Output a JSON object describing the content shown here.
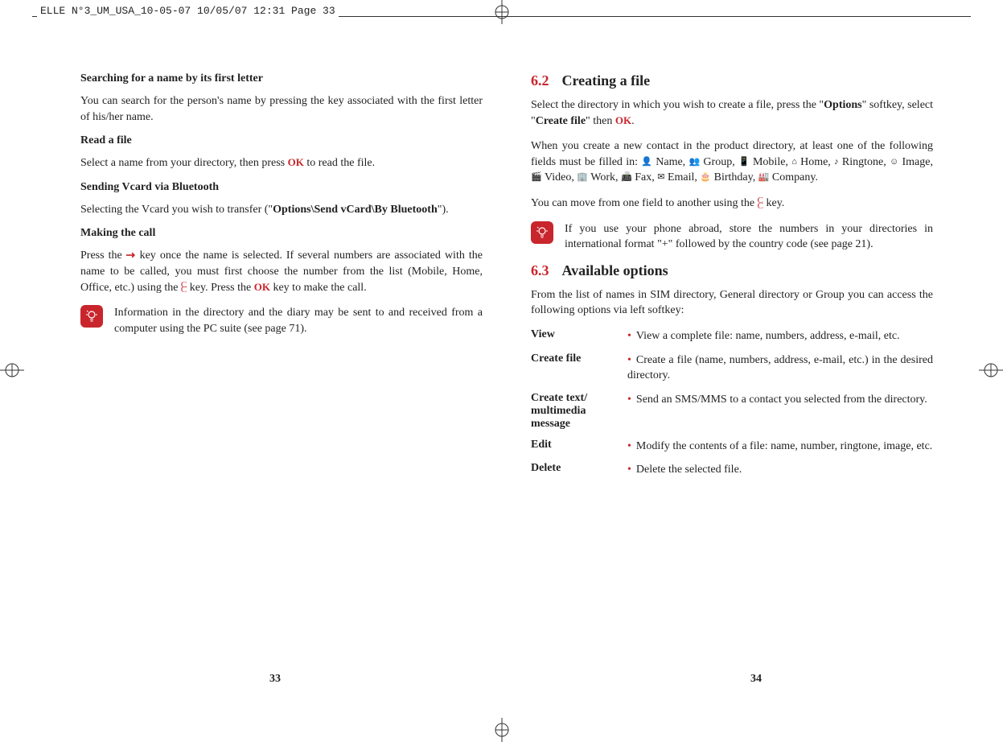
{
  "header": "ELLE N°3_UM_USA_10-05-07  10/05/07  12:31  Page 33",
  "left": {
    "h1": "Searching for a name by its first letter",
    "p1": "You can search for the person's name by pressing the key associated with the first letter of his/her name.",
    "h2": "Read a file",
    "p2a": "Select a name from your directory, then press ",
    "p2b": " to read the file.",
    "h3": "Sending Vcard via Bluetooth",
    "p3a": "Selecting the Vcard you wish to transfer (\"",
    "p3b": "Options\\Send vCard\\By Bluetooth",
    "p3c": "\").",
    "h4": "Making the call",
    "p4a": "Press the ",
    "p4b": " key once the name is selected. If several numbers are associated with the name to be called, you must first choose the number from the list (Mobile, Home, Office, etc.) using the ",
    "p4c": " key. Press the ",
    "p4d": " key to make the call.",
    "note": "Information in the directory and the diary may be sent to and received from a computer using the PC suite (see page 71)."
  },
  "right": {
    "s62num": "6.2",
    "s62title": "Creating a file",
    "p1a": "Select the directory in which you wish to create a file, press the \"",
    "p1b": "Options",
    "p1c": "\" softkey, select \"",
    "p1d": "Create file",
    "p1e": "\" then ",
    "p1f": ".",
    "p2a": "When you create a new contact in the product directory, at least one of the following fields must be filled in: ",
    "fields": {
      "name": " Name, ",
      "group": "  Group, ",
      "mobile": " Mobile, ",
      "home": " Home, ",
      "ringtone": " Ringtone, ",
      "image": " Image, ",
      "video": " Video, ",
      "work": " Work, ",
      "fax": " Fax, ",
      "email": " Email, ",
      "birthday": " Birthday, ",
      "company": " Company."
    },
    "p3a": "You can move from one field to another using the ",
    "p3b": " key.",
    "note": "If you use your phone abroad, store the numbers in your directories in international format \"+\" followed by the country code (see page 21).",
    "s63num": "6.3",
    "s63title": "Available options",
    "p4": "From the list of names in SIM directory, General directory or Group you can access the following options via left softkey:",
    "options": [
      {
        "label": "View",
        "desc": "View a complete file: name, numbers, address, e-mail, etc."
      },
      {
        "label": "Create file",
        "desc": "Create a file (name, numbers, address, e-mail, etc.) in the desired directory."
      },
      {
        "label": "Create text/ multimedia message",
        "desc": "Send an SMS/MMS to a contact you selected from the directory."
      },
      {
        "label": "Edit",
        "desc": "Modify the contents of a file: name, number, ringtone, image, etc."
      },
      {
        "label": "Delete",
        "desc": "Delete the selected file."
      }
    ]
  },
  "ok": "OK",
  "pageLeft": "33",
  "pageRight": "34"
}
